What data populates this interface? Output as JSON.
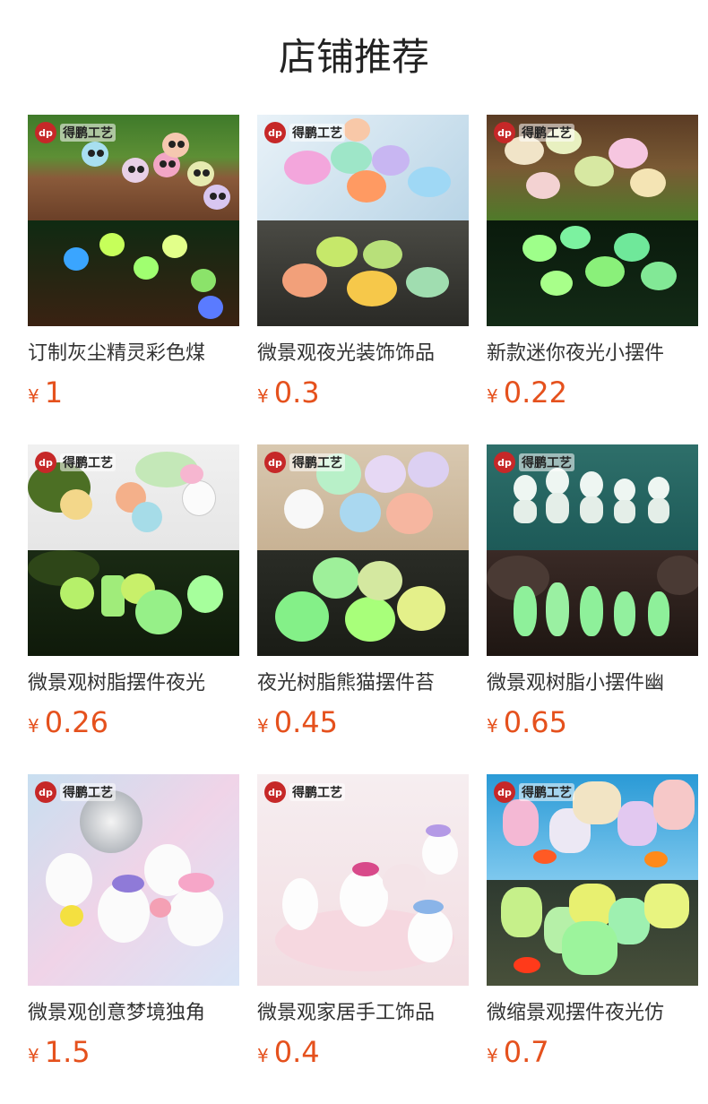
{
  "header": {
    "title": "店铺推荐"
  },
  "brand_label": "得鹏工艺",
  "brand_mark": "dp",
  "currency_symbol": "¥",
  "products": [
    {
      "title": "订制灰尘精灵彩色煤",
      "price": "1",
      "image": "dust-sprite-figurines"
    },
    {
      "title": "微景观夜光装饰饰品",
      "price": "0.3",
      "image": "glow-fish-figurines"
    },
    {
      "title": "新款迷你夜光小摆件",
      "price": "0.22",
      "image": "glow-mushroom-figurines"
    },
    {
      "title": "微景观树脂摆件夜光",
      "price": "0.26",
      "image": "glow-panda-figurines"
    },
    {
      "title": "夜光树脂熊猫摆件苔",
      "price": "0.45",
      "image": "resin-panda-figurines"
    },
    {
      "title": "微景观树脂小摆件幽",
      "price": "0.65",
      "image": "tree-spirit-figurines"
    },
    {
      "title": "微景观创意梦境独角",
      "price": "1.5",
      "image": "unicorn-figurines"
    },
    {
      "title": "微景观家居手工饰品",
      "price": "0.4",
      "image": "unicorn-home-decor"
    },
    {
      "title": "微缩景观摆件夜光仿",
      "price": "0.7",
      "image": "glow-coral-figurines"
    }
  ]
}
